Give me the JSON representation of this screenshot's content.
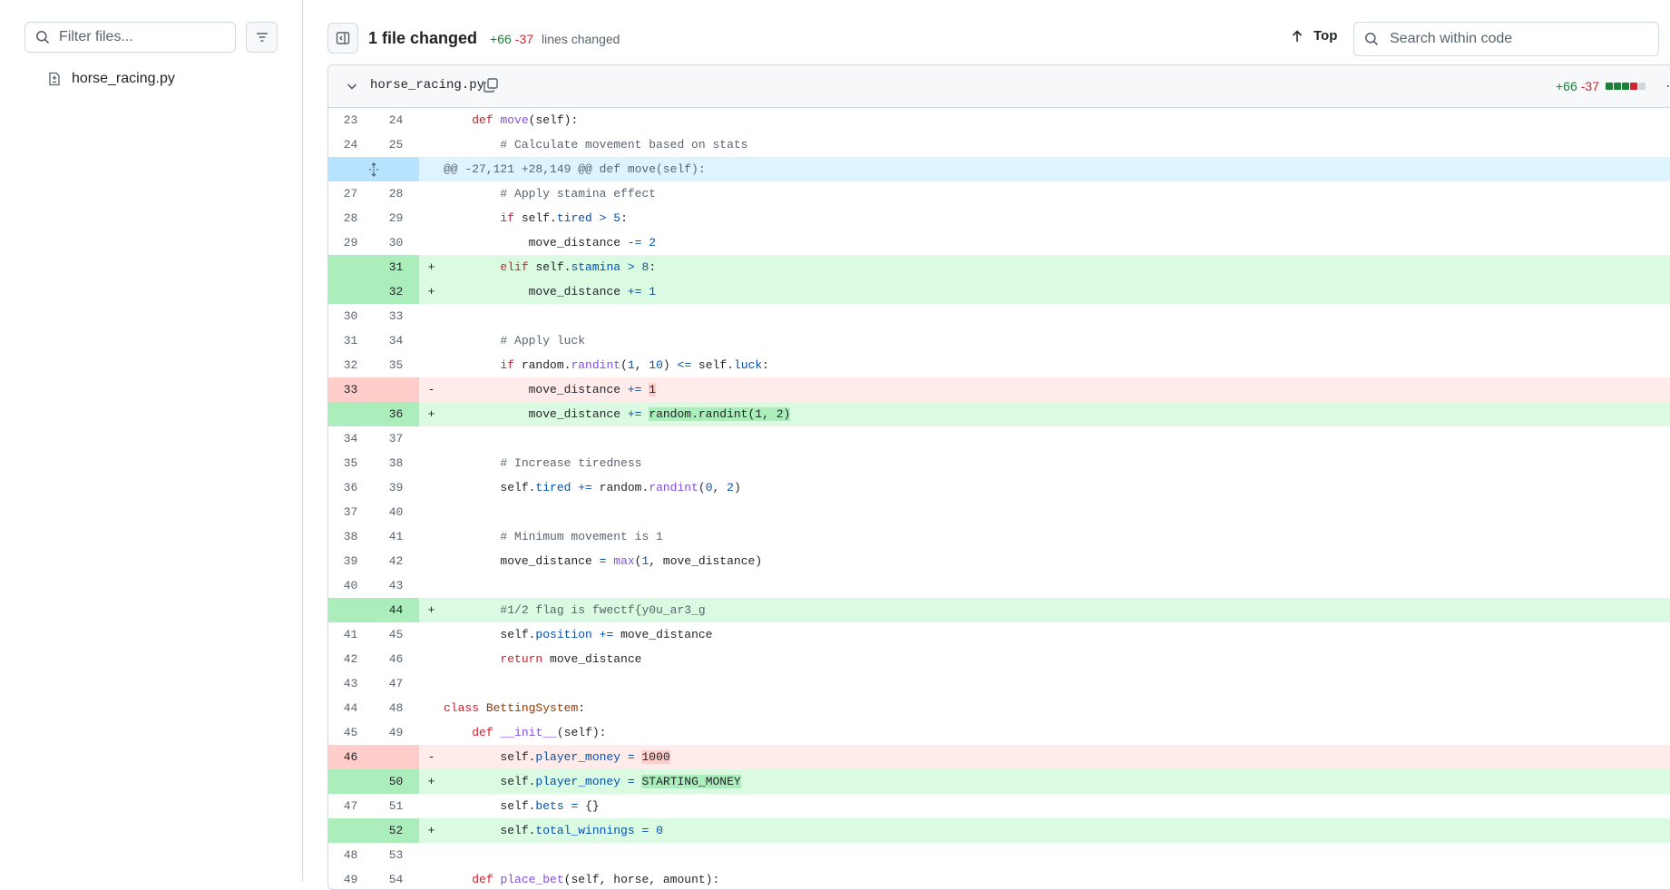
{
  "sidebar": {
    "filter_placeholder": "Filter files...",
    "files": [
      {
        "name": "horse_racing.py"
      }
    ]
  },
  "header": {
    "files_changed": "1 file changed",
    "additions": "+66",
    "deletions": "-37",
    "lines_changed": "lines changed",
    "top_label": "Top",
    "search_placeholder": "Search within code"
  },
  "file": {
    "name": "horse_racing.py",
    "additions": "+66",
    "deletions": "-37",
    "diffstat_colors": [
      "#1a7f37",
      "#1a7f37",
      "#1a7f37",
      "#d1242f",
      "#d0d7de"
    ]
  },
  "colors": {
    "add_bg": "#dafbe1",
    "add_num_bg": "#aceebb",
    "del_bg": "#ffebe9",
    "del_num_bg": "#ffcecb",
    "hunk_bg": "#ddf4ff"
  },
  "diff": [
    {
      "type": "ctx",
      "old": "23",
      "new": "24",
      "code": "    def move(self):"
    },
    {
      "type": "ctx",
      "old": "24",
      "new": "25",
      "code": "        # Calculate movement based on stats"
    },
    {
      "type": "hunk",
      "code": "@@ -27,121 +28,149 @@ def move(self):"
    },
    {
      "type": "ctx",
      "old": "27",
      "new": "28",
      "code": "        # Apply stamina effect"
    },
    {
      "type": "ctx",
      "old": "28",
      "new": "29",
      "code": "        if self.tired > 5:"
    },
    {
      "type": "ctx",
      "old": "29",
      "new": "30",
      "code": "            move_distance -= 2"
    },
    {
      "type": "add",
      "old": "",
      "new": "31",
      "code": "        elif self.stamina > 8:"
    },
    {
      "type": "add",
      "old": "",
      "new": "32",
      "code": "            move_distance += 1"
    },
    {
      "type": "ctx",
      "old": "30",
      "new": "33",
      "code": ""
    },
    {
      "type": "ctx",
      "old": "31",
      "new": "34",
      "code": "        # Apply luck"
    },
    {
      "type": "ctx",
      "old": "32",
      "new": "35",
      "code": "        if random.randint(1, 10) <= self.luck:"
    },
    {
      "type": "del",
      "old": "33",
      "new": "",
      "code": "            move_distance += 1"
    },
    {
      "type": "add",
      "old": "",
      "new": "36",
      "code": "            move_distance += random.randint(1, 2)"
    },
    {
      "type": "ctx",
      "old": "34",
      "new": "37",
      "code": ""
    },
    {
      "type": "ctx",
      "old": "35",
      "new": "38",
      "code": "        # Increase tiredness"
    },
    {
      "type": "ctx",
      "old": "36",
      "new": "39",
      "code": "        self.tired += random.randint(0, 2)"
    },
    {
      "type": "ctx",
      "old": "37",
      "new": "40",
      "code": ""
    },
    {
      "type": "ctx",
      "old": "38",
      "new": "41",
      "code": "        # Minimum movement is 1"
    },
    {
      "type": "ctx",
      "old": "39",
      "new": "42",
      "code": "        move_distance = max(1, move_distance)"
    },
    {
      "type": "ctx",
      "old": "40",
      "new": "43",
      "code": ""
    },
    {
      "type": "add",
      "old": "",
      "new": "44",
      "code": "        #1/2 flag is fwectf{y0u_ar3_g"
    },
    {
      "type": "ctx",
      "old": "41",
      "new": "45",
      "code": "        self.position += move_distance"
    },
    {
      "type": "ctx",
      "old": "42",
      "new": "46",
      "code": "        return move_distance"
    },
    {
      "type": "ctx",
      "old": "43",
      "new": "47",
      "code": ""
    },
    {
      "type": "ctx",
      "old": "44",
      "new": "48",
      "code": "class BettingSystem:"
    },
    {
      "type": "ctx",
      "old": "45",
      "new": "49",
      "code": "    def __init__(self):"
    },
    {
      "type": "del",
      "old": "46",
      "new": "",
      "code": "        self.player_money = 1000"
    },
    {
      "type": "add",
      "old": "",
      "new": "50",
      "code": "        self.player_money = STARTING_MONEY"
    },
    {
      "type": "ctx",
      "old": "47",
      "new": "51",
      "code": "        self.bets = {}"
    },
    {
      "type": "add",
      "old": "",
      "new": "52",
      "code": "        self.total_winnings = 0"
    },
    {
      "type": "ctx",
      "old": "48",
      "new": "53",
      "code": ""
    },
    {
      "type": "ctx",
      "old": "49",
      "new": "54",
      "code": "    def place_bet(self, horse, amount):"
    }
  ]
}
